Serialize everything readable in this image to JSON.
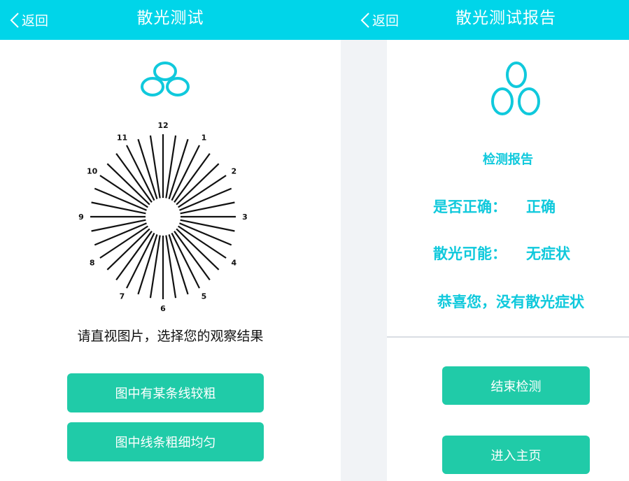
{
  "left": {
    "back_label": "返回",
    "title": "散光测试",
    "clock_numbers": [
      "12",
      "1",
      "2",
      "3",
      "4",
      "5",
      "6",
      "7",
      "8",
      "9",
      "10",
      "11"
    ],
    "instruction": "请直视图片，选择您的观察结果",
    "buttons": [
      "图中有某条线较粗",
      "图中线条粗细均匀"
    ]
  },
  "right": {
    "back_label": "返回",
    "title": "散光测试报告",
    "report_heading": "检测报告",
    "correct_label": "是否正确：",
    "correct_value": "正确",
    "astig_label": "散光可能：",
    "astig_value": "无症状",
    "message": "恭喜您，没有散光症状",
    "end_button": "结束检测",
    "home_button": "进入主页"
  },
  "colors": {
    "header": "#00d5e9",
    "accent": "#10c9dc",
    "button": "#20cba8"
  },
  "icons": {
    "logo": "three-rings-logo-icon",
    "back": "chevron-left-icon"
  }
}
